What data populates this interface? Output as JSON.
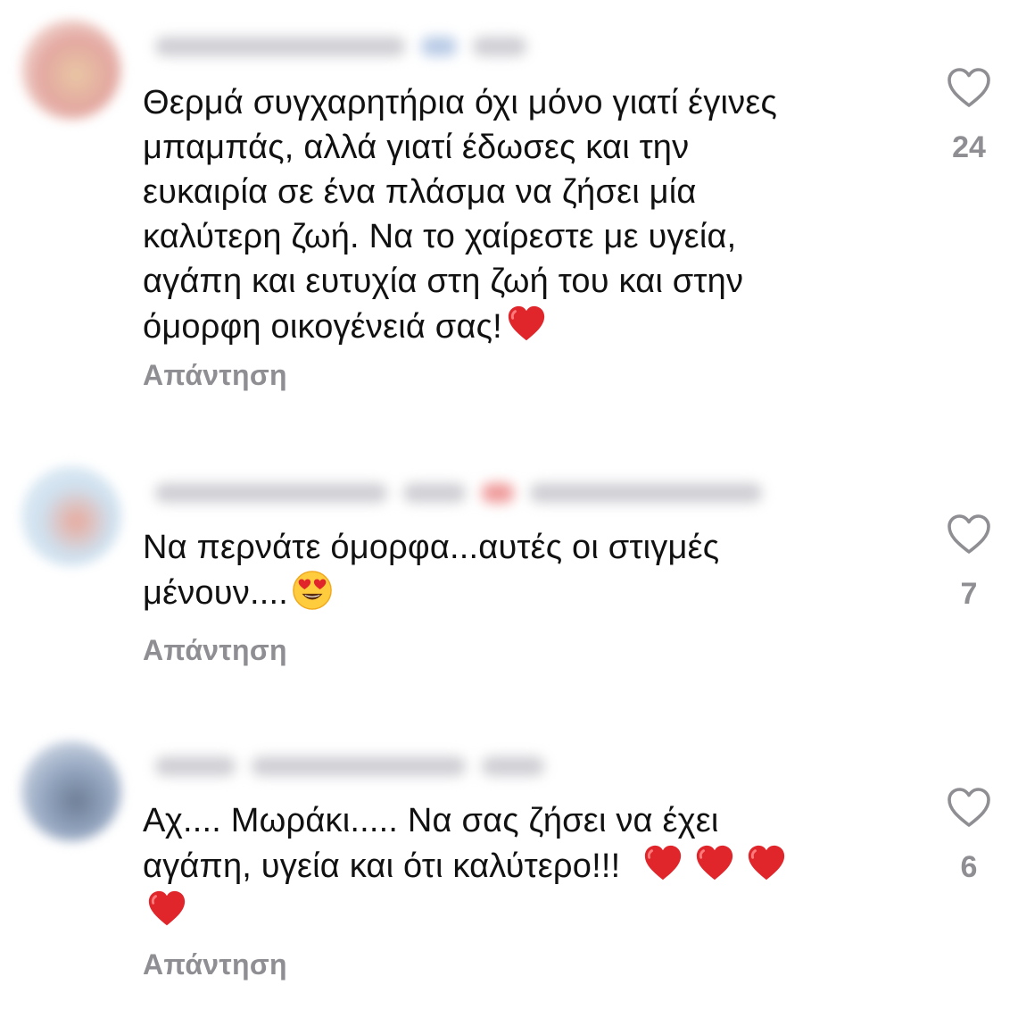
{
  "comments": [
    {
      "text": "Θερμά συγχαρητήρια όχι μόνο γιατί έγινες μπαμπάς, αλλά γιατί έδωσες και την ευκαιρία σε ένα πλάσμα να ζήσει μία καλύτερη ζωή. Να το χαίρεστε με υγεία, αγάπη και ευτυχία στη ζωή του και στην όμορφη οικογένειά σας!",
      "lines": [
        "Θερμά συγχαρητήρια όχι μόνο γιατί έγινες",
        "μπαμπάς, αλλά γιατί έδωσες και την",
        "ευκαιρία σε ένα πλάσμα να ζήσει μία",
        "καλύτερη ζωή. Να το χαίρεστε με υγεία,",
        "αγάπη και ευτυχία στη ζωή του και στην",
        "όμορφη οικογένειά σας!"
      ],
      "emojis": [
        "red-heart"
      ],
      "reply_label": "Απάντηση",
      "likes": "24"
    },
    {
      "text": "Να περνάτε όμορφα...αυτές οι στιγμές μένουν....",
      "lines": [
        "Να περνάτε όμορφα...αυτές οι στιγμές",
        "μένουν...."
      ],
      "emojis": [
        "heart-eyes-face"
      ],
      "reply_label": "Απάντηση",
      "likes": "7"
    },
    {
      "text": "Αχ.... Μωράκι..... Να σας ζήσει να έχει αγάπη, υγεία και ότι καλύτερο!!!",
      "lines": [
        "Αχ.... Μωράκι..... Να σας ζήσει να έχει",
        "αγάπη, υγεία και ότι καλύτερο!!!"
      ],
      "emojis": [
        "red-heart",
        "red-heart",
        "red-heart",
        "red-heart"
      ],
      "reply_label": "Απάντηση",
      "likes": "6"
    }
  ],
  "colors": {
    "text": "#111111",
    "secondary": "#8e8e93",
    "emoji_heart": "#e0252b"
  }
}
